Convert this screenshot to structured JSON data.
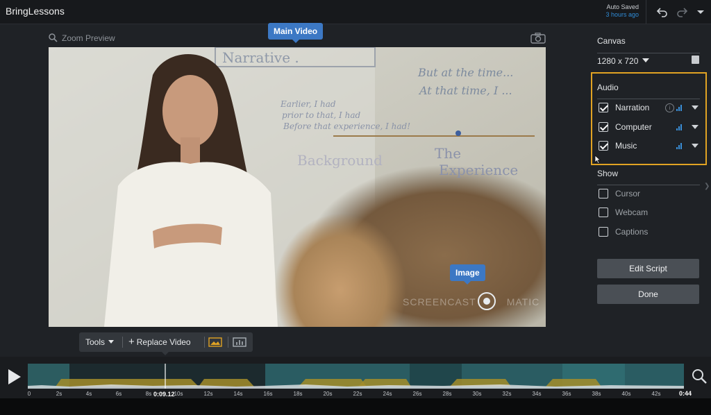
{
  "app": {
    "title": "BringLessons"
  },
  "save_status": {
    "label": "Auto Saved",
    "time": "3 hours ago"
  },
  "preview": {
    "zoom_label": "Zoom Preview",
    "main_callout": "Main Video",
    "image_callout": "Image",
    "watermark_left": "SCREENCAST",
    "watermark_right": "MATIC"
  },
  "board_text": {
    "line1": "Narrative .",
    "line2": "But at the time...",
    "line3": "At that time, I ...",
    "line4": "Earlier, I had",
    "line5": "prior to that, I had",
    "line6": "Before that experience, I had!",
    "line7": "Background",
    "line8": "The",
    "line9": "Experience"
  },
  "panel": {
    "canvas": {
      "title": "Canvas",
      "size": "1280 x 720"
    },
    "audio": {
      "title": "Audio",
      "items": [
        {
          "label": "Narration",
          "checked": true
        },
        {
          "label": "Computer",
          "checked": true
        },
        {
          "label": "Music",
          "checked": true
        }
      ]
    },
    "show": {
      "title": "Show",
      "items": [
        {
          "label": "Cursor",
          "checked": false
        },
        {
          "label": "Webcam",
          "checked": false
        },
        {
          "label": "Captions",
          "checked": false
        }
      ]
    },
    "edit_script": "Edit Script",
    "done": "Done"
  },
  "tools": {
    "tools_label": "Tools",
    "replace_label": "Replace Video"
  },
  "timeline": {
    "playhead": "0:09.12",
    "end": "0:44",
    "ticks": [
      "0",
      "2s",
      "4s",
      "6s",
      "8s",
      "10s",
      "12s",
      "14s",
      "16s",
      "18s",
      "20s",
      "22s",
      "24s",
      "26s",
      "28s",
      "30s",
      "32s",
      "34s",
      "36s",
      "38s",
      "40s",
      "42s"
    ]
  },
  "colors": {
    "accent": "#3c78c4",
    "highlight": "#e1a323",
    "audio_bars": "#3a8fd8",
    "video_clip": "#2f6f73",
    "overlay_clip": "#a38d2a"
  },
  "icons": [
    "search-icon",
    "camera-icon",
    "undo-icon",
    "redo-icon",
    "menu-caret-icon",
    "info-icon",
    "audio-level-icon",
    "plus-icon",
    "image-icon",
    "chart-icon",
    "play-icon"
  ]
}
